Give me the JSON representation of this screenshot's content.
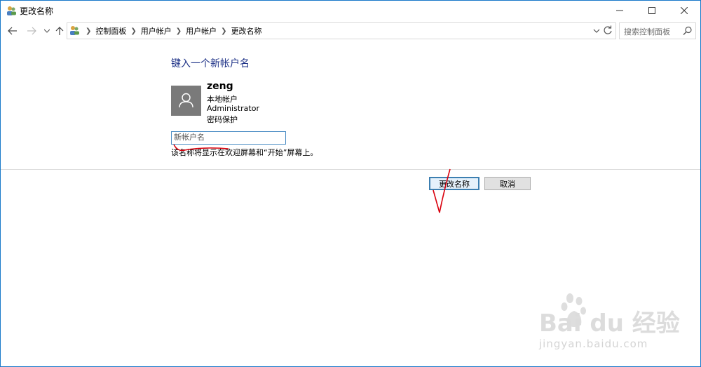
{
  "window": {
    "title": "更改名称",
    "controls": {
      "minimize": "minimize-icon",
      "maximize": "maximize-icon",
      "close": "close-icon"
    }
  },
  "nav": {
    "back": "back-arrow-icon",
    "forward": "forward-arrow-icon",
    "recent": "chevron-down-icon",
    "up": "up-arrow-icon"
  },
  "breadcrumb": [
    "控制面板",
    "用户帐户",
    "用户帐户",
    "更改名称"
  ],
  "search": {
    "placeholder": "搜索控制面板"
  },
  "main": {
    "heading": "键入一个新帐户名",
    "user": {
      "name": "zeng",
      "type": "本地帐户",
      "role": "Administrator",
      "protection": "密码保护"
    },
    "input": {
      "placeholder": "新帐户名",
      "value": ""
    },
    "hint": "该名称将显示在欢迎屏幕和“开始”屏幕上。"
  },
  "buttons": {
    "rename": "更改名称",
    "cancel": "取消"
  },
  "watermark": {
    "brand": "Bai du 经验",
    "url": "jingyan.baidu.com"
  },
  "colors": {
    "heading": "#1e3287",
    "accent": "#3c7fb1",
    "border": "#1979ca",
    "annotation": "#d9000d"
  }
}
